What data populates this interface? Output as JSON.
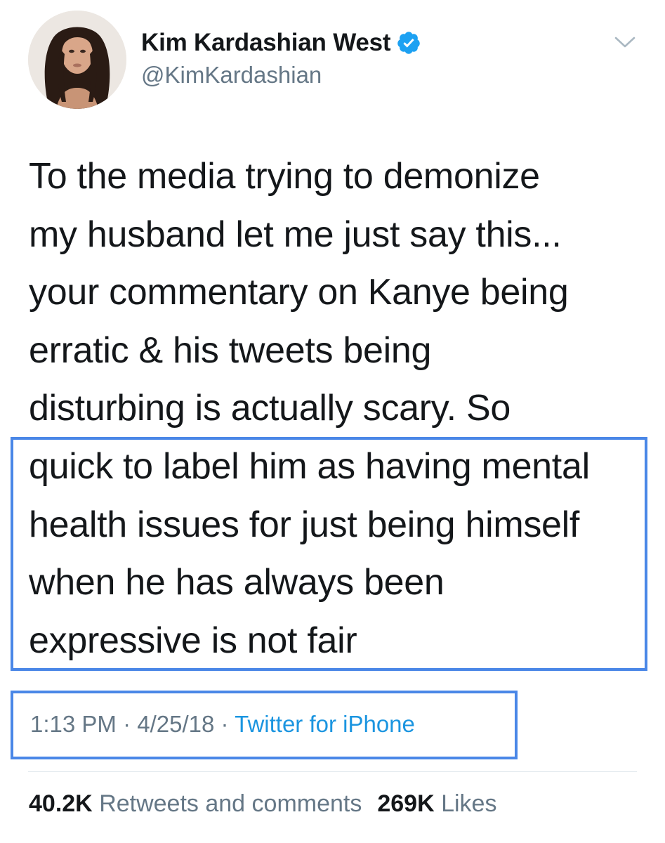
{
  "author": {
    "display_name": "Kim Kardashian West",
    "handle": "@KimKardashian",
    "verified": true
  },
  "tweet": {
    "lines": [
      "To the media trying to demonize",
      "my husband let me just say this...",
      "your commentary on Kanye being",
      "erratic & his tweets being",
      "disturbing is actually scary. So",
      "quick to label him as having mental",
      "health issues for just being himself",
      "when he has always been",
      "expressive is not fair"
    ],
    "time": "1:13 PM",
    "separator": "·",
    "date": "4/25/18",
    "source": "Twitter for iPhone"
  },
  "stats": {
    "retweets_count": "40.2K",
    "retweets_label": "Retweets and comments",
    "likes_count": "269K",
    "likes_label": "Likes"
  },
  "colors": {
    "text": "#14171a",
    "secondary": "#657786",
    "link": "#1b95e0",
    "verified_badge": "#1da1f2",
    "highlight_box": "#4a87e7"
  },
  "icons": {
    "verified": "verified-badge-icon",
    "caret": "chevron-down-icon"
  }
}
